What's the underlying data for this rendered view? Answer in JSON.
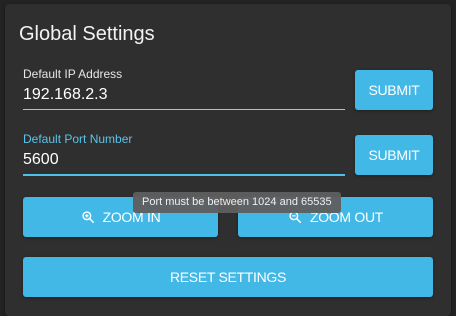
{
  "panel": {
    "title": "Global Settings"
  },
  "ip_field": {
    "label": "Default IP Address",
    "value": "192.168.2.3"
  },
  "port_field": {
    "label": "Default Port Number",
    "value": "5600"
  },
  "buttons": {
    "submit_ip": "SUBMIT",
    "submit_port": "SUBMIT",
    "zoom_in": "ZOOM IN",
    "zoom_out": "ZOOM OUT",
    "reset": "RESET SETTINGS"
  },
  "tooltip": {
    "text": "Port must be between 1024 and 65535"
  },
  "icons": {
    "zoom_in": "zoom-in-icon",
    "zoom_out": "zoom-out-icon"
  },
  "colors": {
    "accent": "#42b8e7",
    "focus": "#4fc0eb",
    "panel": "#2f2f2f",
    "background": "#232323"
  }
}
